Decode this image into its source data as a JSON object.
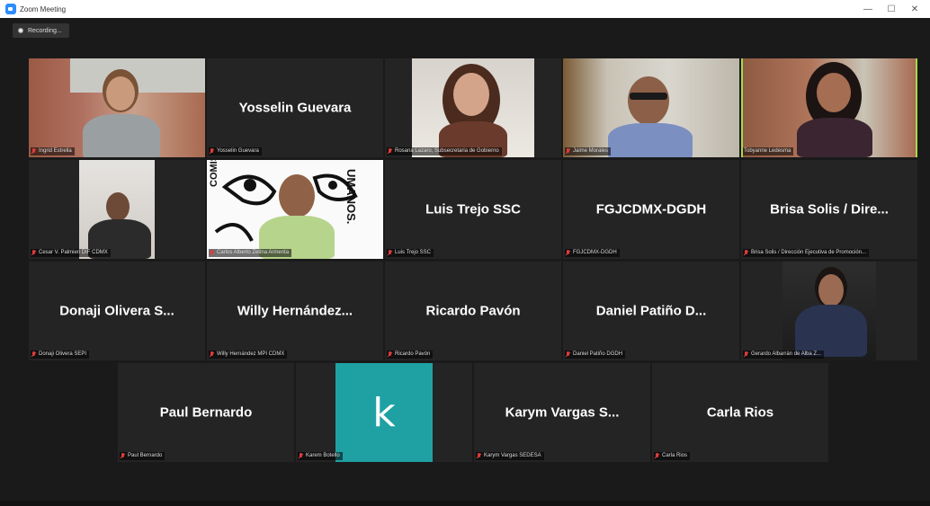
{
  "window": {
    "title": "Zoom Meeting",
    "controls": {
      "minimize": "—",
      "restore": "☐",
      "close": "✕"
    }
  },
  "recording": {
    "label": "Recording..."
  },
  "participants": [
    {
      "label": "Ingrid Estrella"
    },
    {
      "name": "Yosselin Guevara",
      "label": "Yosselin Guevara"
    },
    {
      "label": "Rosana Lazaro, Subsecretaria de Gobierno"
    },
    {
      "label": "Jaime Morales"
    },
    {
      "label": "Tobyanne Ledesma"
    },
    {
      "label": "Cesar V. Palmieri DIF CDMX"
    },
    {
      "label": "Carlos Alberto Zetina Armenta",
      "logo_text": "COMISIÓN",
      "logo_text2": "UMANOS."
    },
    {
      "name": "Luis Trejo SSC",
      "label": "Luis Trejo SSC"
    },
    {
      "name": "FGJCDMX-DGDH",
      "label": "FGJCDMX-DGDH"
    },
    {
      "name": "Brisa Solis / Dire...",
      "label": "Brisa Solis / Dirección Ejecutiva de Promoción..."
    },
    {
      "name": "Donaji Olivera S...",
      "label": "Donaji Olivera SEPI"
    },
    {
      "name": "Willy  Hernández...",
      "label": "Willy Hernández MPI CDMX"
    },
    {
      "name": "Ricardo Pavón",
      "label": "Ricardo Pavón"
    },
    {
      "name": "Daniel Patiño D...",
      "label": "Daniel Patiño DGDH"
    },
    {
      "label": "Gerardo Albarrán de Alba Z..."
    },
    {
      "name": "Paul Bernardo",
      "label": "Paul Bernardo"
    },
    {
      "avatar_letter": "k",
      "label": "Karem Botello"
    },
    {
      "name": "Karym Vargas S...",
      "label": "Karym Vargas SEDESA"
    },
    {
      "name": "Carla Rios",
      "label": "Carla Rios"
    }
  ],
  "colors": {
    "active_speaker": "#a6d94b",
    "tile_bg": "#242424",
    "stage_bg": "#1a1a1a",
    "avatar_k": "#1fa1a4",
    "muted": "#e03b3b"
  }
}
